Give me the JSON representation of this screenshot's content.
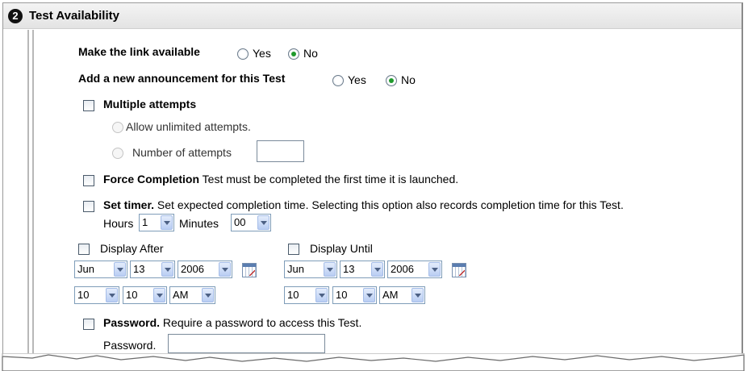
{
  "section": {
    "number": "❷",
    "title": "Test Availability"
  },
  "link_available": {
    "label": "Make the link available",
    "yes": "Yes",
    "no": "No",
    "selected": "No"
  },
  "announcement": {
    "label": "Add a new announcement for this Test",
    "yes": "Yes",
    "no": "No",
    "selected": "No"
  },
  "multiple_attempts": {
    "label": "Multiple attempts",
    "checked": false,
    "unlimited_label": "Allow unlimited attempts.",
    "number_label": "Number of attempts",
    "number_value": ""
  },
  "force_completion": {
    "label": "Force Completion",
    "description": "Test must be completed the first time it is launched.",
    "checked": false
  },
  "timer": {
    "label": "Set timer.",
    "description": "Set expected completion time. Selecting this option also records completion time for this Test.",
    "hours_label": "Hours",
    "hours_value": "1",
    "minutes_label": "Minutes",
    "minutes_value": "00",
    "checked": false
  },
  "display_after": {
    "label": "Display After",
    "month": "Jun",
    "day": "13",
    "year": "2006",
    "hour": "10",
    "minute": "10",
    "ampm": "AM",
    "checked": false
  },
  "display_until": {
    "label": "Display Until",
    "month": "Jun",
    "day": "13",
    "year": "2006",
    "hour": "10",
    "minute": "10",
    "ampm": "AM",
    "checked": false
  },
  "password": {
    "label": "Password.",
    "description": "Require a password to access this Test.",
    "field_label": "Password.",
    "value": "",
    "checked": false
  },
  "colors": {
    "radio_selected": "#1f9a2c",
    "select_border": "#7f9db9",
    "header_bg": "#e8e8e8"
  },
  "icons": {
    "step": "step-2-icon",
    "calendar": "calendar-icon",
    "dropdown": "chevron-down-icon"
  }
}
